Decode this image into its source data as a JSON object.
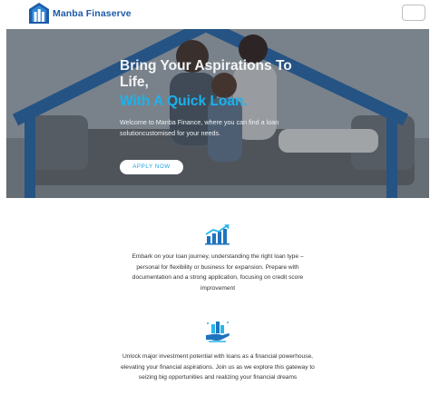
{
  "brand": {
    "name": "Manba Finaserve",
    "logo_icon": "building-logo-icon",
    "color": "#1e5aa8"
  },
  "nav": {
    "toggle_icon": "hamburger-menu-icon"
  },
  "hero": {
    "title": "Bring Your Aspirations To Life,",
    "subtitle": "With A Quick Loan.",
    "description": "Welcome to Manba Finance, where you can find a loan solutioncustomised for your needs.",
    "cta_label": "APPLY NOW",
    "accent_color": "#1ab3ee"
  },
  "features": [
    {
      "icon": "growth-chart-icon",
      "text": "Embark on your loan journey, understanding the right loan type – personal for flexibility or business for expansion. Prepare with documentation and a strong application, focusing on credit score improvement"
    },
    {
      "icon": "hand-with-city-icon",
      "text": "Unlock major investment potential with loans as a financial powerhouse, elevating your financial aspirations. Join us as we explore this gateway to seizing big opportunities and realizing your financial dreams"
    }
  ]
}
